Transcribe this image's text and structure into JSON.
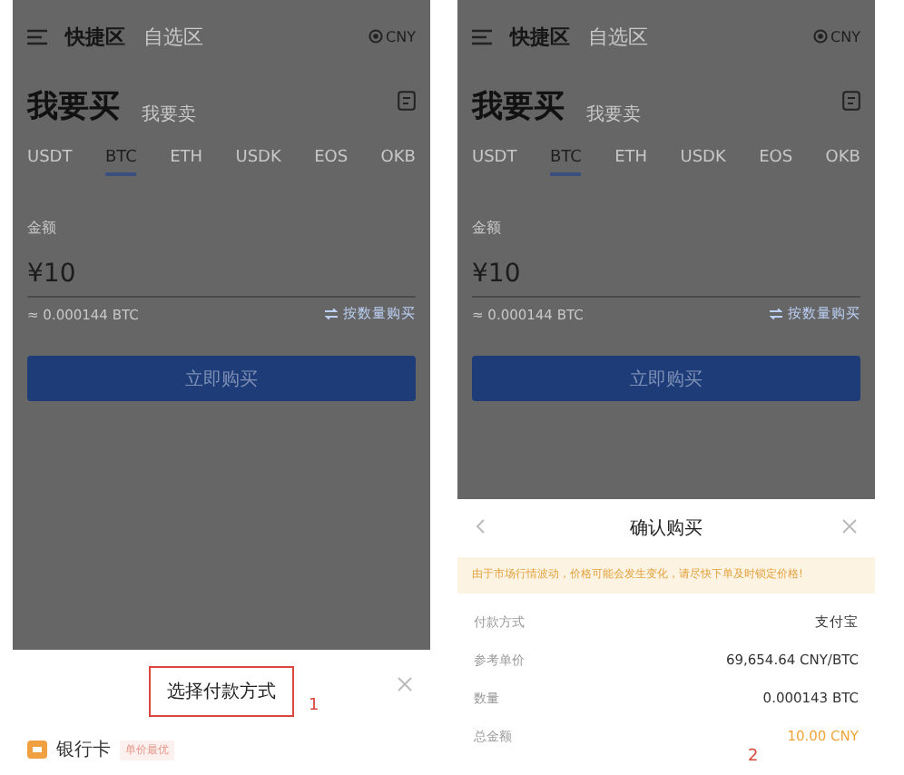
{
  "screens": [
    {
      "header": {
        "tabs": [
          {
            "label": "快捷区",
            "selected": true
          },
          {
            "label": "自选区",
            "selected": false
          }
        ],
        "currency": "CNY"
      },
      "sides": [
        {
          "label": "我要买",
          "selected": true
        },
        {
          "label": "我要卖",
          "selected": false
        }
      ],
      "coins": [
        {
          "label": "USDT",
          "selected": false
        },
        {
          "label": "BTC",
          "selected": true
        },
        {
          "label": "ETH",
          "selected": false
        },
        {
          "label": "USDK",
          "selected": false
        },
        {
          "label": "EOS",
          "selected": false
        },
        {
          "label": "OKB",
          "selected": false
        }
      ],
      "amount": {
        "label": "金额",
        "value": "¥10",
        "estimate": "≈ 0.000144 BTC",
        "switch_link": "按数量购买"
      },
      "buy_button": "立即购买",
      "sheet": {
        "kind": "payment-picker",
        "title": "选择付款方式",
        "highlighted": true,
        "marker": "1",
        "methods": [
          {
            "label": "银行卡",
            "tag": "单价最优"
          }
        ]
      }
    },
    {
      "header": {
        "tabs": [
          {
            "label": "快捷区",
            "selected": true
          },
          {
            "label": "自选区",
            "selected": false
          }
        ],
        "currency": "CNY"
      },
      "sides": [
        {
          "label": "我要买",
          "selected": true
        },
        {
          "label": "我要卖",
          "selected": false
        }
      ],
      "coins": [
        {
          "label": "USDT",
          "selected": false
        },
        {
          "label": "BTC",
          "selected": true
        },
        {
          "label": "ETH",
          "selected": false
        },
        {
          "label": "USDK",
          "selected": false
        },
        {
          "label": "EOS",
          "selected": false
        },
        {
          "label": "OKB",
          "selected": false
        }
      ],
      "amount": {
        "label": "金额",
        "value": "¥10",
        "estimate": "≈ 0.000144 BTC",
        "switch_link": "按数量购买"
      },
      "buy_button": "立即购买",
      "sheet": {
        "kind": "confirm-buy",
        "title": "确认购买",
        "highlighted": false,
        "marker": "2",
        "notice": "由于市场行情波动，价格可能会发生变化，请尽快下单及时锁定价格!",
        "rows": [
          {
            "label": "付款方式",
            "value": "支付宝",
            "emphasis": false
          },
          {
            "label": "参考单价",
            "value": "69,654.64 CNY/BTC",
            "emphasis": false
          },
          {
            "label": "数量",
            "value": "0.000143 BTC",
            "emphasis": false
          },
          {
            "label": "总金额",
            "value": "10.00 CNY",
            "emphasis": true
          }
        ]
      }
    }
  ]
}
